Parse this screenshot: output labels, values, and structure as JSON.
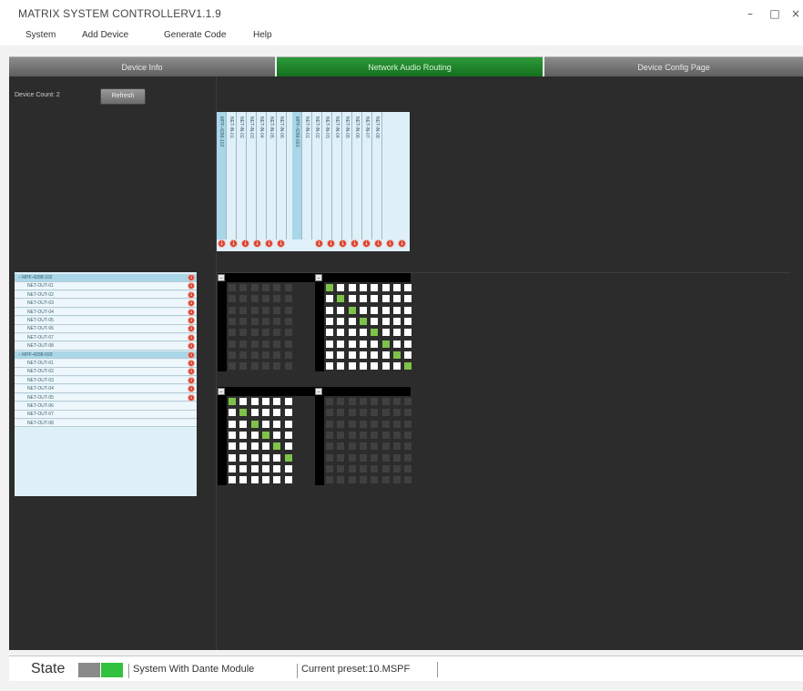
{
  "window": {
    "title": "MATRIX SYSTEM CONTROLLERV1.1.9",
    "minimize_icon": "minimize-icon",
    "maximize_icon": "maximize-icon",
    "close_icon": "close-icon"
  },
  "menu": [
    "System",
    "Add Device",
    "Generate Code",
    "Help"
  ],
  "tabs": [
    {
      "label": "Device Info",
      "active": false
    },
    {
      "label": "Network Audio Routing",
      "active": true
    },
    {
      "label": "Device Config Page",
      "active": false
    }
  ],
  "routing": {
    "device_count_label": "Device Count: 2",
    "refresh_label": "Refresh",
    "receivers": [
      {
        "device": "MPF-4288-102",
        "channels": [
          "NET-IN-01",
          "NET-IN-02",
          "NET-IN-03",
          "NET-IN-04",
          "NET-IN-05",
          "NET-IN-06"
        ]
      },
      {
        "device": "MPF-4288-693",
        "channels": [
          "NET-IN-01",
          "NET-IN-02",
          "NET-IN-03",
          "NET-IN-04",
          "NET-IN-05",
          "NET-IN-06",
          "NET-IN-07",
          "NET-IN-08"
        ]
      }
    ],
    "transmitters": [
      {
        "device": "MPF-4288-102",
        "channels": [
          "NET-OUT-01",
          "NET-OUT-02",
          "NET-OUT-03",
          "NET-OUT-04",
          "NET-OUT-05",
          "NET-OUT-06",
          "NET-OUT-07",
          "NET-OUT-08"
        ]
      },
      {
        "device": "MPF-4288-693",
        "channels": [
          "NET-OUT-01",
          "NET-OUT-02",
          "NET-OUT-03",
          "NET-OUT-04",
          "NET-OUT-05",
          "NET-OUT-06",
          "NET-OUT-07",
          "NET-OUT-08"
        ]
      }
    ],
    "status_icon": "error-dot-icon",
    "colors": {
      "active_tab": "#1f8a2c",
      "route_on": "#7ec24a",
      "panel": "#2c2c2c",
      "list_bg": "#dff0f8"
    }
  },
  "status": {
    "state_label": "State",
    "mode": "System With Dante Module",
    "preset": "Current preset:10.MSPF",
    "indicator_color": "#32c13e"
  }
}
